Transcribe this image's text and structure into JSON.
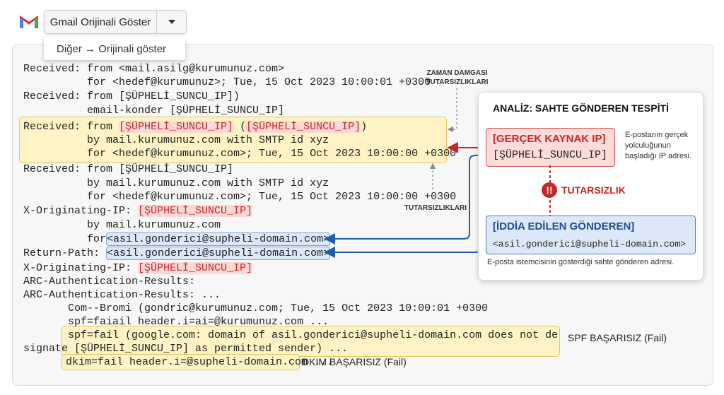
{
  "toolbar": {
    "show_original_label": "Gmail Orijinali Göster",
    "menu_item": "Diğer → Orijinali göster"
  },
  "header_lines": {
    "l1": "Received: from <mail.asilg@kurumunuz.com>",
    "l2": "          for <hedef@kurumunuz>; Tue, 15 Oct 2023 10:00:01 +0300",
    "l3": "Received: from [ŞÜPHELİ_SUNCU_IP])",
    "l4": "          email-konder [ŞÜPHELİ_SUNCU_IP]",
    "l5_pre": "Received: from ",
    "l5_a": "[ŞÜPHELİ_SUNCU_IP]",
    "l5_mid": " (",
    "l5_b": "[ŞÜPHELİ_SUNCU_IP]",
    "l5_post": ")",
    "l6": "          by mail.kurumunuz.com with SMTP id xyz",
    "l7": "          for <hedef@kurumunuz.com>; Tue, 15 Oct 2023 10:00:00 +0300",
    "l8": "Received: from [ŞÜPHELİ_SUNCU_IP]",
    "l9": "          by mail.kurumunuz.com with SMTP id xyz",
    "l10": "          for <hedef@kurumunuz.com>; Tue, 15 Oct 2023 10:00:00 +0300",
    "l11_pre": "X-Originating-IP: ",
    "l11_ip": "[ŞÜPHELİ_SUNCU_IP]",
    "l12": "          by mail.kurumunuz.com",
    "l13_pre": "          for",
    "l13_addr": "<asil.gonderici@supheli-domain.com>",
    "l14_pre": "Return-Path: ",
    "l14_addr": "<asil.gonderici@supheli-domain.com>",
    "l15_pre": "X-Originating-IP: ",
    "l15_ip": "[ŞÜPHELİ_SUNCU_IP]",
    "l16": "ARC-Authentication-Results:",
    "l17": "ARC-Authentication-Results: ...",
    "l18": "       Com-‐Bromi (gondric@kurumunuz.com; Tue, 15 Oct 2023 10:00:01 +0300",
    "l19": "       spf=faiail header.i=ai=@kurumunuz.com ...",
    "l20": "       spf=fail (google.com: domain of asil.gonderici@supheli-domain.com does not de",
    "l21": "signate [ŞÜPHELİ_SUNCU_IP] as permitted sender) ...",
    "l22": "dkim=fail header.i=@supheli-domain.com",
    "l22_post": " ..."
  },
  "annotations": {
    "timestamp_top": "ZAMAN DAMGASI\nTUTARSIZLIKLARI",
    "timestamp_bottom": "TUTARSIZLIKLARI",
    "spf_label": "SPF BAŞARISIZ (Fail)",
    "dkim_label": "DKIM BAŞARISIZ (Fail)"
  },
  "analysis": {
    "title": "ANALİZ: SAHTE GÖNDEREN TESPİTİ",
    "real_title": "[GERÇEK KAYNAK IP]",
    "real_value": "[ŞÜPHELİ_SUNCU_IP]",
    "real_desc": "E-postanın gerçek yolculuğunun başladığı IP adresi.",
    "warn_symbol": "!!",
    "warn_label": "TUTARSIZLIK",
    "claim_title": "[İDDİA EDİLEN GÖNDEREN]",
    "claim_value": "<asil.gonderici@supheli-domain.com>",
    "claim_desc": "E-posta istemcisinin gösterdiği sahte gönderen adresi."
  },
  "colors": {
    "accent_red": "#c62828",
    "accent_blue": "#1f5fa6",
    "highlight_yellow": "#fdf3c4",
    "highlight_blue": "#dce8f7",
    "highlight_red": "#fbd9d6"
  },
  "icons": [
    "gmail-logo-icon",
    "chevron-down-icon",
    "warning-icon"
  ]
}
